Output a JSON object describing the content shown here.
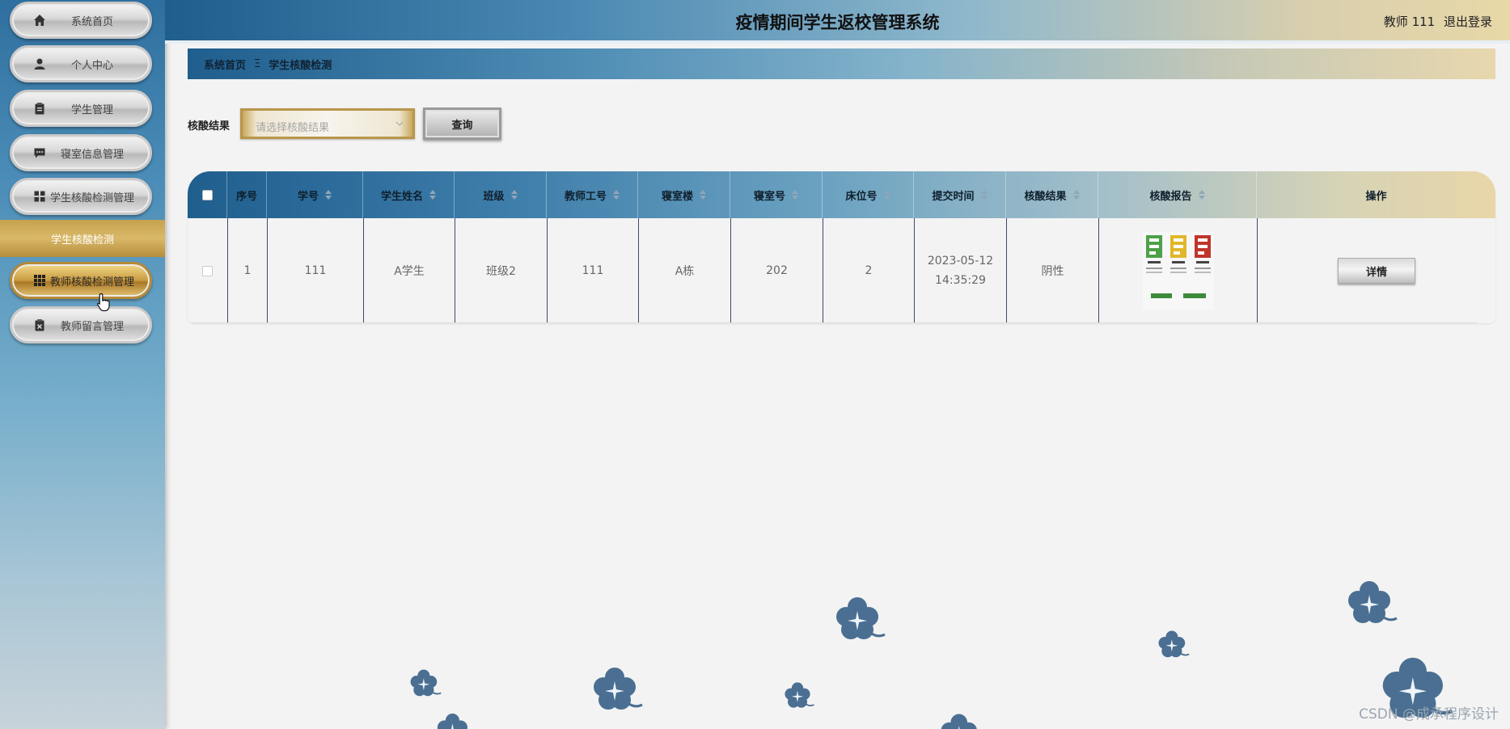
{
  "sidebar": {
    "items": [
      {
        "label": "系统首页",
        "icon": "home-icon"
      },
      {
        "label": "个人中心",
        "icon": "user-icon"
      },
      {
        "label": "学生管理",
        "icon": "clipboard-icon"
      },
      {
        "label": "寝室信息管理",
        "icon": "chat-icon"
      },
      {
        "label": "学生核酸检测管理",
        "icon": "grid-icon"
      },
      {
        "label": "学生核酸检测",
        "icon": ""
      },
      {
        "label": "教师核酸检测管理",
        "icon": "apps-icon"
      },
      {
        "label": "教师留言管理",
        "icon": "clipboard-x-icon"
      }
    ]
  },
  "header": {
    "title": "疫情期间学生返校管理系统",
    "user": "教师 111",
    "logout": "退出登录"
  },
  "breadcrumb": {
    "home": "系统首页",
    "sep": "Ξ",
    "current": "学生核酸检测"
  },
  "search": {
    "label": "核酸结果",
    "placeholder": "请选择核酸结果",
    "button": "查询"
  },
  "table": {
    "headers": [
      "序号",
      "学号",
      "学生姓名",
      "班级",
      "教师工号",
      "寝室楼",
      "寝室号",
      "床位号",
      "提交时间",
      "核酸结果",
      "核酸报告",
      "操作"
    ],
    "rows": [
      {
        "index": "1",
        "student_id": "111",
        "name": "A学生",
        "class": "班级2",
        "teacher_id": "111",
        "building": "A栋",
        "room": "202",
        "bed": "2",
        "time": "2023-05-12 14:35:29",
        "result": "阴性",
        "action": "详情"
      }
    ]
  },
  "watermark": "CSDN @成承程序设计",
  "colors": {
    "accent_blue": "#1f5e8d",
    "accent_gold": "#c89b3f",
    "clover": "#4a6f92"
  }
}
